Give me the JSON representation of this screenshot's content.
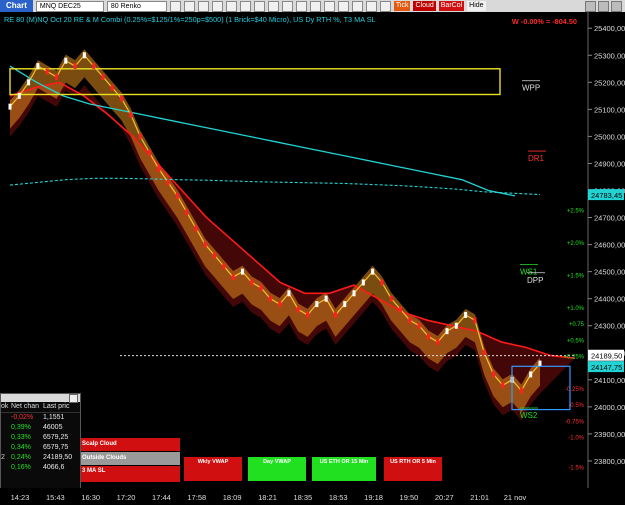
{
  "toolbar": {
    "chart_tab": "Chart",
    "symbol": "MNQ DEC25",
    "bar_type": "80 Renko",
    "toggles": [
      "Tick",
      "Cloud",
      "BarCol",
      "Hide"
    ]
  },
  "header_text": "RE 80 (M)NQ Oct 20 RE & M Combi (0.25%=$125/1%=250p=$500)  (1 Brick=$40 Micro), US Dy RTH %, T3 MA SL",
  "pnl_text": "W -0.00% = -804.50",
  "colors": {
    "up_brick": "#ffffff",
    "down_brick": "#ff2020",
    "cloud_orange": "#e08a1e",
    "cloud_red": "#5a0a0a",
    "wpp_box": "#e8e020",
    "cyan_line": "#22d3d3",
    "red_line": "#ff1a1a",
    "price_tag": "#22d3d3"
  },
  "chart_data": {
    "type": "line",
    "x_labels": [
      "14:23",
      "15:43",
      "16:30",
      "17:20",
      "17:44",
      "17:58",
      "18:09",
      "18:21",
      "18:35",
      "18:53",
      "19:18",
      "19:50",
      "20:27",
      "21:01",
      "21 nov"
    ],
    "y_ticks": [
      25400,
      25300,
      25200,
      25100,
      25000,
      24900,
      24800,
      24700,
      24600,
      24500,
      24400,
      24300,
      24200,
      24100,
      24000,
      23900,
      23800
    ],
    "y_tick_labels": [
      "25400,00",
      "25300,00",
      "25200,00",
      "25100,00",
      "25000,00",
      "24900,00",
      "24800,00",
      "24700,00",
      "24600,00",
      "24500,00",
      "24400,00",
      "24300,00",
      "24200,00",
      "24100,00",
      "24000,00",
      "23900,00",
      "23800,00"
    ],
    "ylim": [
      23700,
      25460
    ],
    "pct_levels": [
      {
        "label": "+2.5%",
        "value": 24730,
        "color": "#20e020"
      },
      {
        "label": "+2.0%",
        "value": 24610,
        "color": "#20e020"
      },
      {
        "label": "+1.5%",
        "value": 24490,
        "color": "#20e020"
      },
      {
        "label": "+1.0%",
        "value": 24370,
        "color": "#20e020"
      },
      {
        "label": "+0.75",
        "value": 24310,
        "color": "#20e020"
      },
      {
        "label": "+0.5%",
        "value": 24250,
        "color": "#20e020"
      },
      {
        "label": "+0.25%",
        "value": 24190,
        "color": "#20e020"
      },
      {
        "label": "-0.25%",
        "value": 24070,
        "color": "#ff3030"
      },
      {
        "label": "-0.5%",
        "value": 24010,
        "color": "#ff3030"
      },
      {
        "label": "-0.75%",
        "value": 23950,
        "color": "#ff3030"
      },
      {
        "label": "-1.0%",
        "value": 23890,
        "color": "#ff3030"
      },
      {
        "label": "-1.5%",
        "value": 23780,
        "color": "#ff3030"
      }
    ],
    "level_labels": [
      {
        "label": "WPP",
        "value": 25180,
        "color": "#dddddd"
      },
      {
        "label": "DR1",
        "value": 24920,
        "color": "#ff3030"
      },
      {
        "label": "WS1",
        "value": 24500,
        "color": "#20e020"
      },
      {
        "label": "DPP",
        "value": 24470,
        "color": "#dddddd"
      },
      {
        "label": "WS2",
        "value": 23970,
        "color": "#20e020"
      }
    ],
    "price_tags": [
      {
        "value": "24783,45",
        "y": 24783,
        "bg": "#22d3d3"
      },
      {
        "value": "24189,50",
        "y": 24189,
        "bg": "#ffffff"
      },
      {
        "value": "24147,75",
        "y": 24147,
        "bg": "#22d3d3"
      }
    ],
    "price": [
      25110,
      25150,
      25200,
      25260,
      25240,
      25220,
      25280,
      25260,
      25300,
      25260,
      25220,
      25180,
      25140,
      25080,
      25000,
      24940,
      24880,
      24830,
      24780,
      24720,
      24660,
      24600,
      24560,
      24520,
      24480,
      24500,
      24460,
      24440,
      24400,
      24380,
      24420,
      24360,
      24340,
      24380,
      24400,
      24340,
      24380,
      24420,
      24460,
      24500,
      24460,
      24400,
      24360,
      24320,
      24300,
      24260,
      24240,
      24280,
      24300,
      24340,
      24320,
      24200,
      24120,
      24080,
      24100,
      24060,
      24120,
      24160
    ],
    "cyan_line": [
      25260,
      25200,
      25150,
      25120,
      25100,
      25080,
      25060,
      25040,
      25020,
      25000,
      24980,
      24960,
      24940,
      24920,
      24900,
      24880,
      24860,
      24840,
      24800,
      24780
    ],
    "dotted_line": [
      24820,
      24830,
      24840,
      24845,
      24845,
      24843,
      24840,
      24838,
      24835,
      24832,
      24830,
      24828,
      24826,
      24822,
      24818,
      24812,
      24805,
      24795,
      24790,
      24785
    ],
    "red_line": [
      25150,
      25180,
      25200,
      25150,
      25080,
      25000,
      24900,
      24800,
      24700,
      24620,
      24540,
      24460,
      24420,
      24420,
      24450,
      24400,
      24350,
      24320,
      24300,
      24280,
      24240,
      24220,
      24190,
      24180
    ],
    "wpp_box": {
      "y_top": 25250,
      "y_bottom": 25155
    },
    "cur_price": 24189.5
  },
  "quotes": {
    "columns": [
      "ok",
      "Net chan",
      "Last pric"
    ],
    "rows": [
      {
        "c1": "",
        "net": "-0,02%",
        "last": "1,1551",
        "net_color": "#ff3030"
      },
      {
        "c1": "",
        "net": "0,39%",
        "last": "46005",
        "net_color": "#20e020"
      },
      {
        "c1": "",
        "net": "0,33%",
        "last": "6579,25",
        "net_color": "#20e020"
      },
      {
        "c1": "",
        "net": "0,34%",
        "last": "6579,75",
        "net_color": "#20e020"
      },
      {
        "c1": "2",
        "net": "0,24%",
        "last": "24189,50",
        "net_color": "#20e020"
      },
      {
        "c1": "",
        "net": "0,16%",
        "last": "4066,6",
        "net_color": "#20e020"
      }
    ]
  },
  "buttons": {
    "scalp_cloud": "Scalp Cloud",
    "outside_clouds": "Outside Clouds",
    "ma_sl": "3 MA SL",
    "wkly_vwap": "Wkly VWAP",
    "day_vwap": "Day VWAP",
    "us_eth_or": "US ETH OR 15 Min",
    "us_rth_or": "US RTH OR 5 Min"
  }
}
